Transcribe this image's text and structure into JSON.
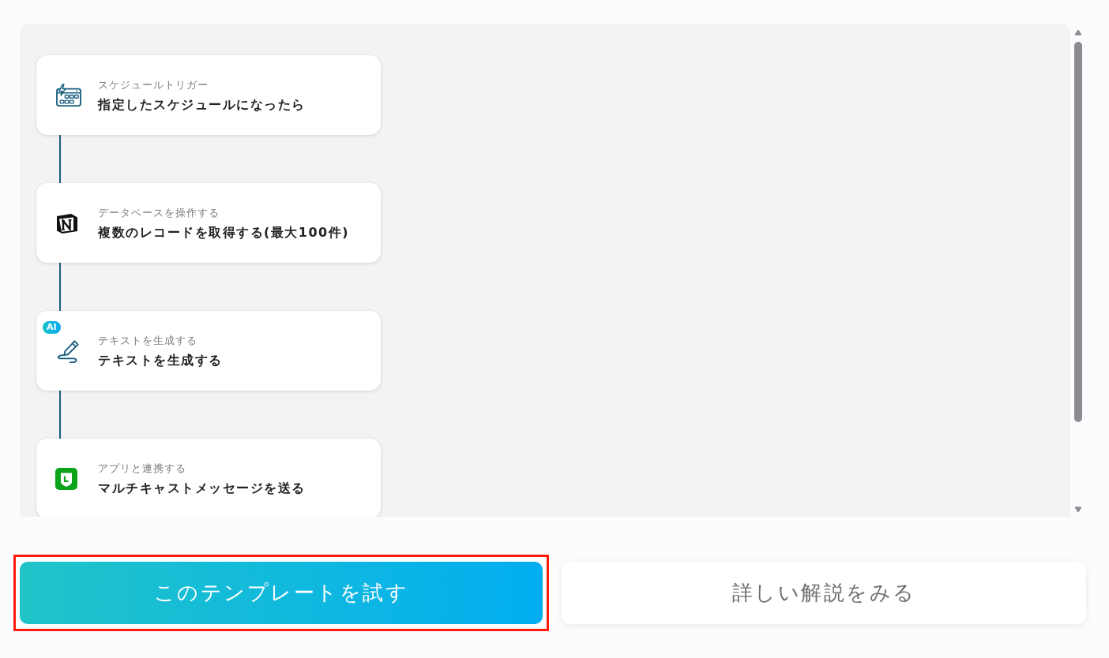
{
  "flow": {
    "steps": [
      {
        "kind": "schedule",
        "category": "スケジュールトリガー",
        "title": "指定したスケジュールになったら"
      },
      {
        "kind": "database",
        "category": "データベースを操作する",
        "title": "複数のレコードを取得する(最大100件)"
      },
      {
        "kind": "ai",
        "badge": "AI",
        "category": "テキストを生成する",
        "title": "テキストを生成する"
      },
      {
        "kind": "app",
        "category": "アプリと連携する",
        "title": "マルチキャストメッセージを送る"
      }
    ]
  },
  "buttons": [
    {
      "kind": "primary",
      "label": "このテンプレートを試す",
      "highlighted": true
    },
    {
      "kind": "secondary",
      "label": "詳しい解説をみる",
      "highlighted": false
    }
  ]
}
